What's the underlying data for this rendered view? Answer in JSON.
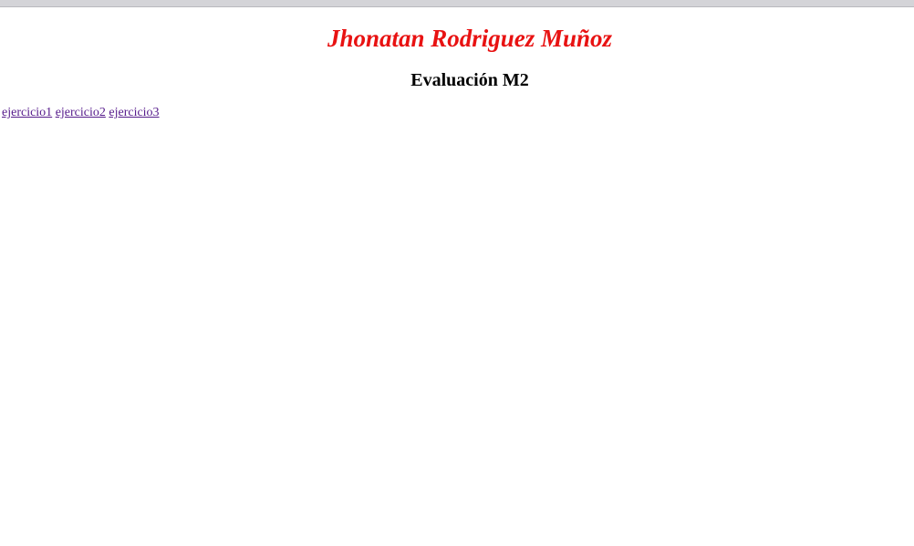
{
  "header": {
    "title": "Jhonatan Rodriguez Muñoz",
    "subtitle": "Evaluación M2",
    "title_color": "#e81212"
  },
  "nav": {
    "links": [
      {
        "label": "ejercicio1"
      },
      {
        "label": "ejercicio2"
      },
      {
        "label": "ejercicio3"
      }
    ],
    "link_color": "#551a8b"
  }
}
